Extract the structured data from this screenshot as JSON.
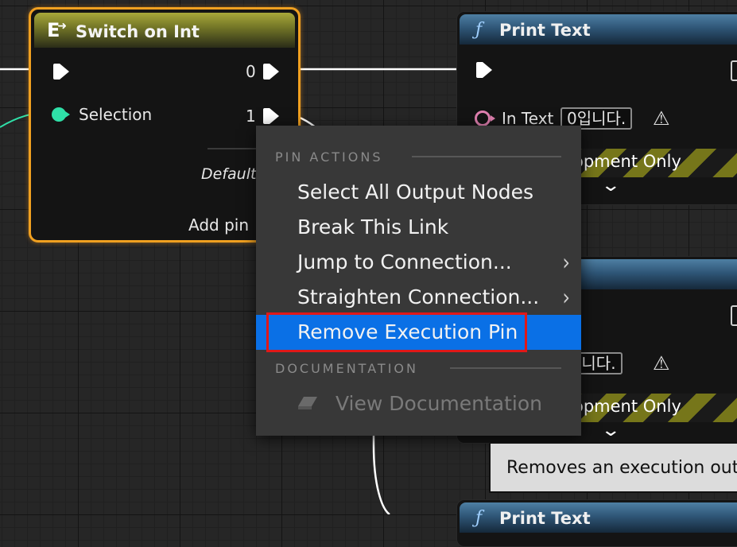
{
  "switch_node": {
    "title": "Switch on Int",
    "selection_label": "Selection",
    "out_0_label": "0",
    "out_1_label": "1",
    "default_label": "Default",
    "add_pin_label": "Add pin"
  },
  "print_nodes": [
    {
      "title": "Print Text",
      "in_text_label": "In Text",
      "in_text_value": "0입니다.",
      "dev_label": "opment Only"
    },
    {
      "title": "",
      "in_text_value": "입니다.",
      "dev_label": "opment Only"
    },
    {
      "title": "Print Text"
    }
  ],
  "context_menu": {
    "sections": [
      {
        "header": "PIN ACTIONS",
        "items": [
          {
            "label": "Select All Output Nodes",
            "submenu": false
          },
          {
            "label": "Break This Link",
            "submenu": false
          },
          {
            "label": "Jump to Connection...",
            "submenu": true
          },
          {
            "label": "Straighten Connection...",
            "submenu": true
          },
          {
            "label": "Remove Execution Pin",
            "submenu": false,
            "highlighted": true
          }
        ]
      },
      {
        "header": "DOCUMENTATION",
        "items": [
          {
            "label": "View Documentation",
            "disabled": true
          }
        ]
      }
    ]
  },
  "tooltip": {
    "text": "Removes an execution outp"
  },
  "colors": {
    "highlight": "#0a70e6",
    "annotation_box": "#e01818",
    "selected_node_border": "#f0a020",
    "exec_pin": "#ffffff",
    "int_pin": "#2fe0a8",
    "text_pin": "#e080b0"
  },
  "icons": {
    "switch": "switch-node-icon",
    "function": "function-icon",
    "warning": "warning-icon",
    "chevron": "chevron-down-icon",
    "submenu": "chevron-right-icon",
    "documentation": "eraser-icon"
  }
}
